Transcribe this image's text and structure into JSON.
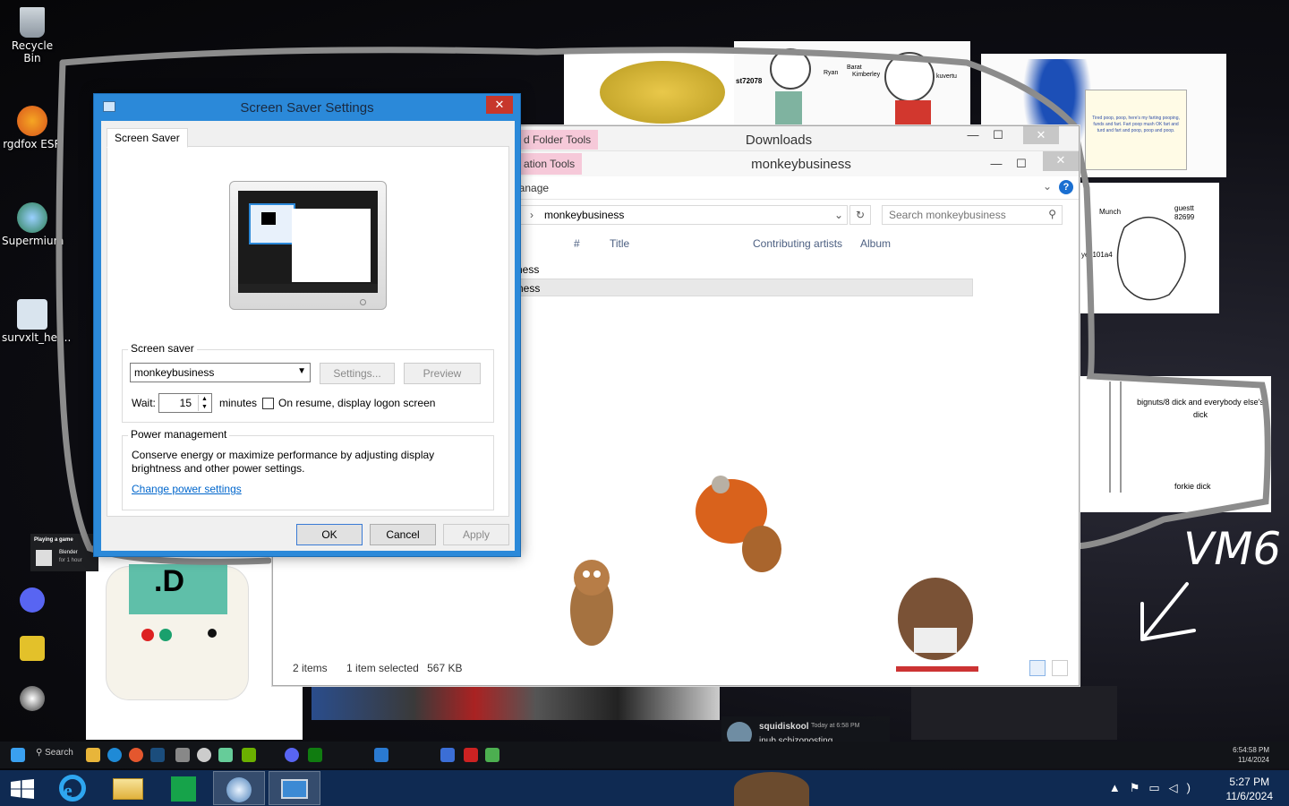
{
  "desktop": {
    "icons": [
      {
        "label": "Recycle Bin"
      },
      {
        "label": "rgdfox ESR"
      },
      {
        "label": "Supermium"
      },
      {
        "label": "survxlt_her..."
      }
    ],
    "mini_icons": [
      "Recycle Bin",
      "Need for Speed",
      "Logitech G HUB",
      "Oracle VM VirtualBox",
      "BlueStacks",
      "Discord",
      "Geometry Dash",
      "Ubisoft Connect"
    ],
    "game_card": {
      "heading": "Playing a game",
      "game": "Blender",
      "duration": "for 1 hour"
    },
    "notes": {
      "sticky": "Tired poop, poop, here's my farting pooping, funds and fart. Fart poop mush OK fart and turd and fart and poop, poop and poop.",
      "drawing_top": [
        "Munch",
        "guestt 82699",
        "yes101a4"
      ],
      "drawing_mid": [
        "bignuts/8 dick and everybody else's dick",
        "forkie dick"
      ],
      "handwritten": "VM6",
      "meme_label": "st72078",
      "meme_names": [
        "Ryan",
        "Barat",
        "Kimberley",
        "kuvertu"
      ]
    }
  },
  "explorer": {
    "title_top": "Downloads",
    "ctx_top": "d Folder Tools",
    "title": "monkeybusiness",
    "ctx_tab": "ation Tools",
    "ribbon_tab": "lanage",
    "address": {
      "crumb_sep": "›",
      "path": "monkeybusiness"
    },
    "search_placeholder": "Search monkeybusiness",
    "columns": [
      "#",
      "Title",
      "Contributing artists",
      "Album"
    ],
    "rows": [
      "ness",
      "ness"
    ],
    "status": {
      "items": "2 items",
      "selected": "1 item selected",
      "size": "567 KB"
    }
  },
  "dialog": {
    "title": "Screen Saver Settings",
    "tab": "Screen Saver",
    "saver_group": "Screen saver",
    "saver_selected": "monkeybusiness",
    "settings_button": "Settings...",
    "preview_button": "Preview",
    "wait_label": "Wait:",
    "wait_value": "15",
    "minutes_label": "minutes",
    "resume_label": "On resume, display logon screen",
    "resume_checked": false,
    "power_group": "Power management",
    "power_text": "Conserve energy or maximize performance by adjusting display brightness and other power settings.",
    "power_link": "Change power settings",
    "ok": "OK",
    "cancel": "Cancel",
    "apply": "Apply"
  },
  "vm_taskbar": {
    "search": "Search",
    "clock_time": "6:54:58 PM",
    "clock_date": "11/4/2024"
  },
  "notification": {
    "name": "squidiskool",
    "time": "Today at 6:58 PM",
    "message": "inub schizoposting"
  },
  "taskbar": {
    "apps": [
      "internet-explorer",
      "file-explorer",
      "store",
      "virtualbox",
      "remote-desktop"
    ],
    "time": "5:27 PM",
    "date": "11/6/2024"
  },
  "colors": {
    "accent": "#2b89d9",
    "taskbar": "#0f2a52",
    "close": "#c7372b",
    "ctx_tab": "#f6c9d9",
    "link": "#0066cc"
  }
}
